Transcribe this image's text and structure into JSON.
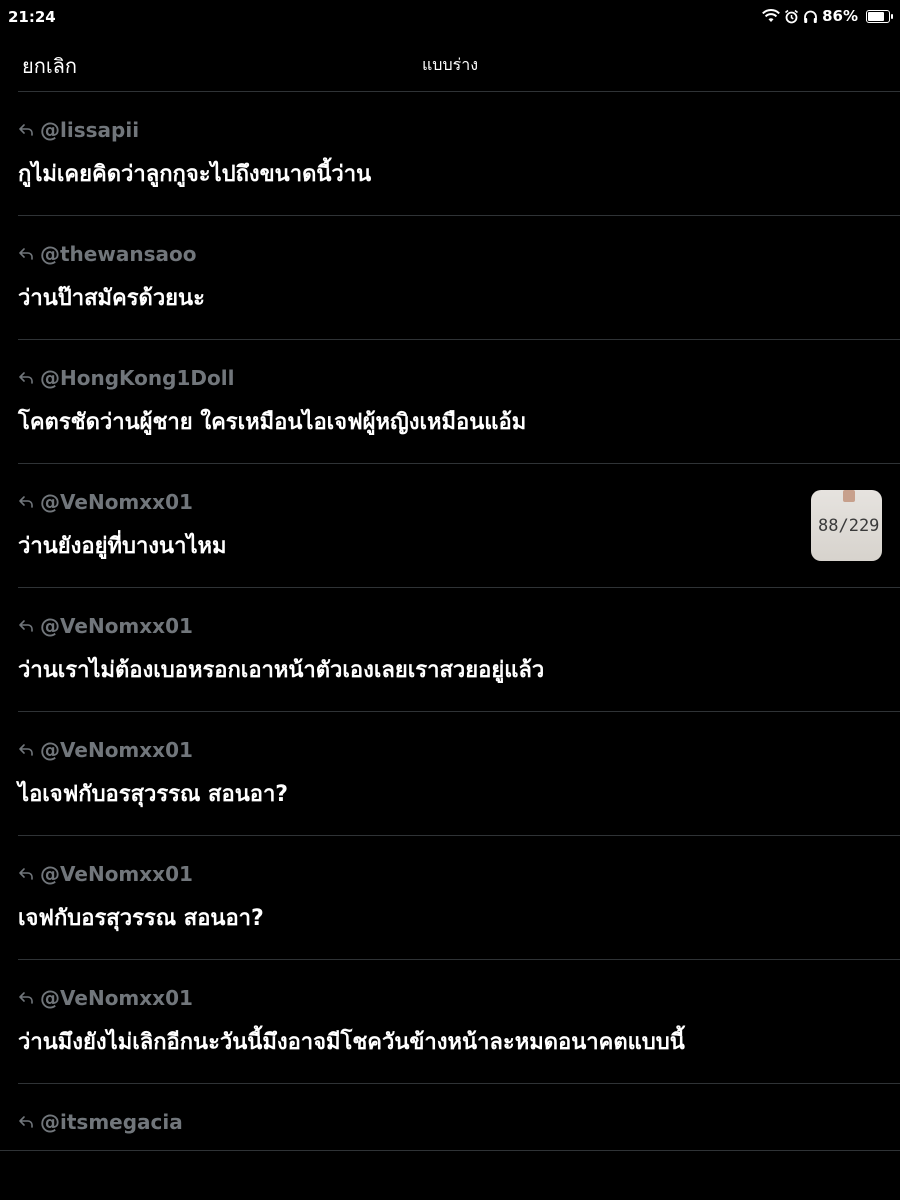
{
  "status": {
    "time": "21:24",
    "battery": "86%",
    "battery_level": 0.86
  },
  "header": {
    "cancel_label": "ยกเลิก",
    "title": "แบบร่าง"
  },
  "drafts": [
    {
      "handle": "@lissapii",
      "text": "กูไม่เคยคิดว่าลูกกูจะไปถึงขนาดนี้ว่าน",
      "has_thumb": false
    },
    {
      "handle": "@thewansaoo",
      "text": "ว่านป๊าสมัครด้วยนะ",
      "has_thumb": false
    },
    {
      "handle": "@HongKong1Doll",
      "text": "โคตรชัดว่านผู้ชาย ใครเหมือนไอเจฟผู้หญิงเหมือนแอ้ม",
      "has_thumb": false
    },
    {
      "handle": "@VeNomxx01",
      "text": "ว่านยังอยู่ที่บางนาไหม",
      "has_thumb": true,
      "thumb_text": "88/229"
    },
    {
      "handle": "@VeNomxx01",
      "text": "ว่านเราไม่ต้องเบอหรอกเอาหน้าตัวเองเลยเราสวยอยู่แล้ว",
      "has_thumb": false
    },
    {
      "handle": "@VeNomxx01",
      "text": "ไอเจฟกับอรสุวรรณ สอนอา?",
      "has_thumb": false
    },
    {
      "handle": "@VeNomxx01",
      "text": "เจฟกับอรสุวรรณ สอนอา?",
      "has_thumb": false
    },
    {
      "handle": "@VeNomxx01",
      "text": "ว่านมึงยังไม่เลิกอีกนะวันนี้มึงอาจมีโชควันข้างหน้าละหมดอนาคตแบบนี้",
      "has_thumb": false
    },
    {
      "handle": "@itsmegacia",
      "text": "",
      "has_thumb": false
    }
  ],
  "icons": {
    "reply": "reply-arrow-icon",
    "wifi": "wifi-icon",
    "alarm": "alarm-icon",
    "headphones": "headphones-icon",
    "battery": "battery-icon"
  },
  "colors": {
    "background": "#000000",
    "handle": "#71767b",
    "divider": "#2f3336",
    "text": "#ffffff"
  }
}
